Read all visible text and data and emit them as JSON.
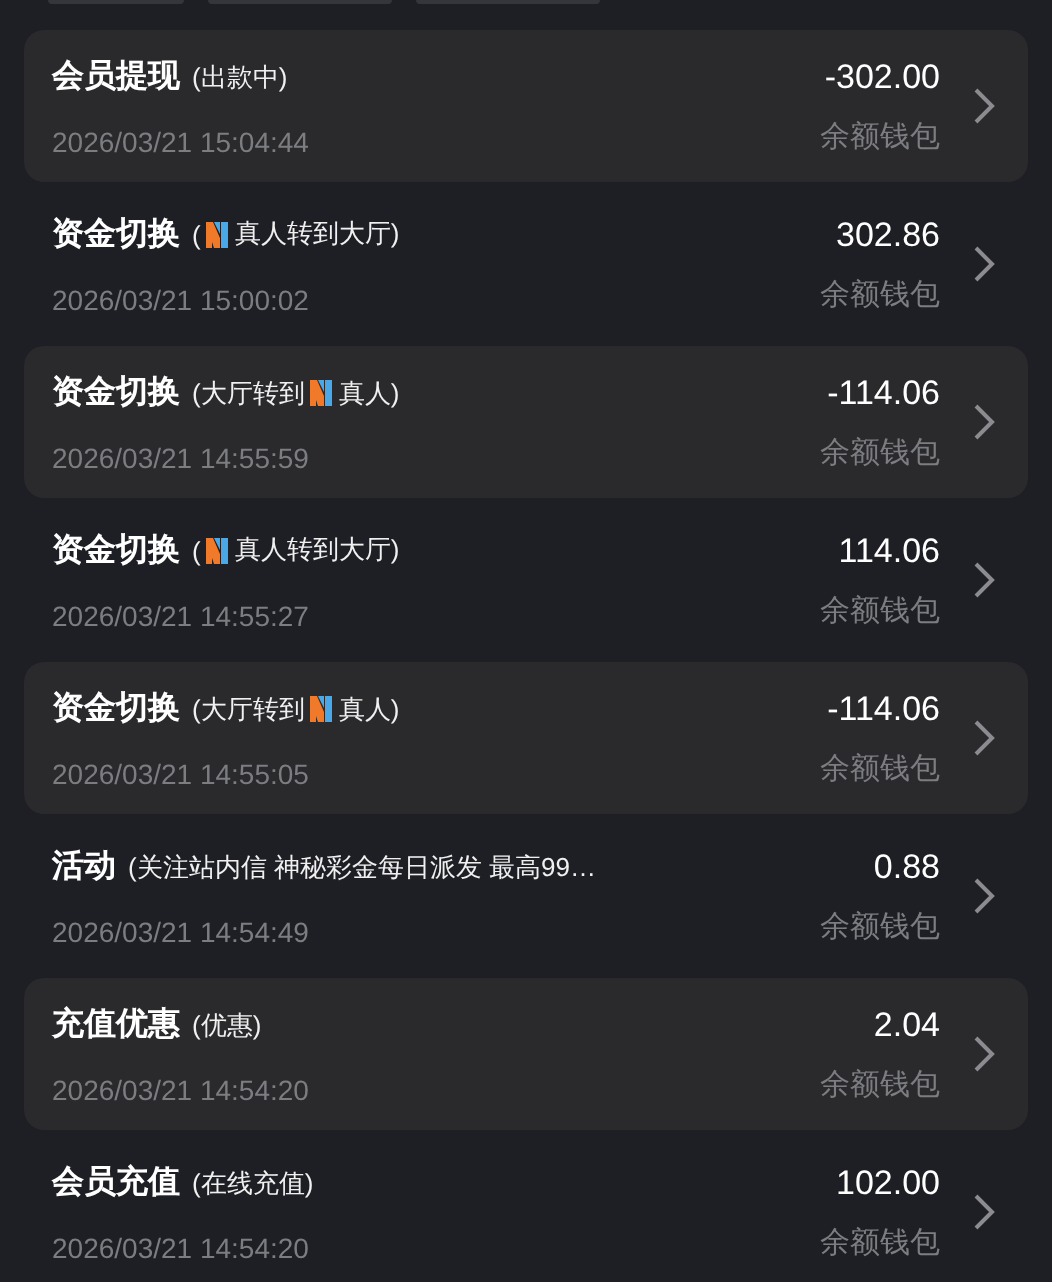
{
  "filter_tabs": [
    {
      "selected": false
    },
    {
      "selected": false
    },
    {
      "selected": false
    }
  ],
  "records": [
    {
      "title": "会员提现",
      "detail": [
        {
          "kind": "text",
          "text": "(出款中)"
        }
      ],
      "time": "2026/03/21 15:04:44",
      "amount": "-302.00",
      "wallet": "余额钱包",
      "shaded": true
    },
    {
      "title": "资金切换",
      "detail": [
        {
          "kind": "text",
          "text": "("
        },
        {
          "kind": "logo"
        },
        {
          "kind": "text",
          "text": "真人转到大厅)"
        }
      ],
      "time": "2026/03/21 15:00:02",
      "amount": "302.86",
      "wallet": "余额钱包",
      "shaded": false
    },
    {
      "title": "资金切换",
      "detail": [
        {
          "kind": "text",
          "text": "(大厅转到"
        },
        {
          "kind": "logo"
        },
        {
          "kind": "text",
          "text": "真人)"
        }
      ],
      "time": "2026/03/21 14:55:59",
      "amount": "-114.06",
      "wallet": "余额钱包",
      "shaded": true
    },
    {
      "title": "资金切换",
      "detail": [
        {
          "kind": "text",
          "text": "("
        },
        {
          "kind": "logo"
        },
        {
          "kind": "text",
          "text": "真人转到大厅)"
        }
      ],
      "time": "2026/03/21 14:55:27",
      "amount": "114.06",
      "wallet": "余额钱包",
      "shaded": false
    },
    {
      "title": "资金切换",
      "detail": [
        {
          "kind": "text",
          "text": "(大厅转到"
        },
        {
          "kind": "logo"
        },
        {
          "kind": "text",
          "text": "真人)"
        }
      ],
      "time": "2026/03/21 14:55:05",
      "amount": "-114.06",
      "wallet": "余额钱包",
      "shaded": true
    },
    {
      "title": "活动",
      "detail": [
        {
          "kind": "text",
          "text": "(关注站内信 神秘彩金每日派发 最高99…"
        }
      ],
      "time": "2026/03/21 14:54:49",
      "amount": "0.88",
      "wallet": "余额钱包",
      "shaded": false
    },
    {
      "title": "充值优惠",
      "detail": [
        {
          "kind": "text",
          "text": "(优惠)"
        }
      ],
      "time": "2026/03/21 14:54:20",
      "amount": "2.04",
      "wallet": "余额钱包",
      "shaded": true
    },
    {
      "title": "会员充值",
      "detail": [
        {
          "kind": "text",
          "text": "(在线充值)"
        }
      ],
      "time": "2026/03/21 14:54:20",
      "amount": "102.00",
      "wallet": "余额钱包",
      "shaded": false
    }
  ]
}
